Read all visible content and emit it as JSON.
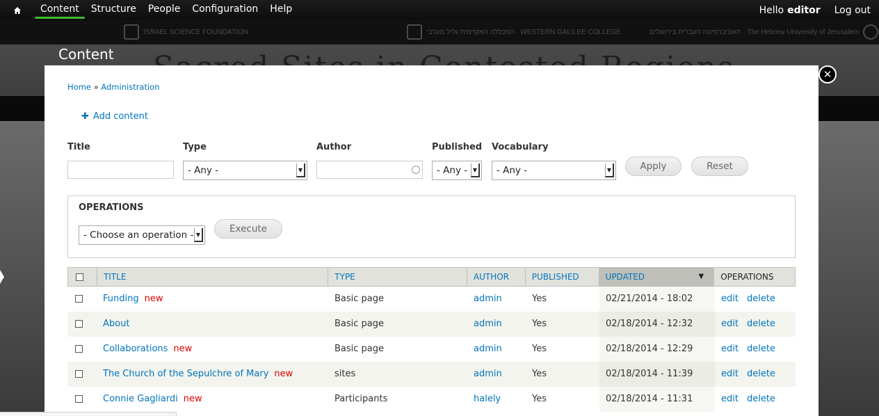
{
  "toolbar": {
    "menu": [
      "Content",
      "Structure",
      "People",
      "Configuration",
      "Help"
    ],
    "hello": "Hello",
    "user": "editor",
    "logout": "Log out"
  },
  "logos": {
    "left": "ISRAEL SCIENCE FOUNDATION",
    "center": "המכללה האקדמית גליל מערבי · WESTERN GALILEE COLLEGE",
    "right": "האוניברסיטה העברית בירושלים · The Hebrew University of Jerusalem"
  },
  "page": {
    "title": "Content",
    "bg_title": "Sacred Sites in Contested Regions"
  },
  "breadcrumb": {
    "home": "Home",
    "sep": "»",
    "admin": "Administration"
  },
  "add_content": "Add content",
  "filters": {
    "title_label": "Title",
    "type_label": "Type",
    "type_value": "- Any -",
    "author_label": "Author",
    "published_label": "Published",
    "published_value": "- Any -",
    "vocabulary_label": "Vocabulary",
    "vocabulary_value": "- Any -",
    "apply": "Apply",
    "reset": "Reset"
  },
  "operations": {
    "legend": "OPERATIONS",
    "select_value": "- Choose an operation -",
    "execute": "Execute"
  },
  "table": {
    "headers": {
      "title": "TITLE",
      "type": "TYPE",
      "author": "AUTHOR",
      "published": "PUBLISHED",
      "updated": "UPDATED",
      "operations": "OPERATIONS"
    },
    "rows": [
      {
        "title": "Funding",
        "new": "new",
        "type": "Basic page",
        "author": "admin",
        "published": "Yes",
        "updated": "02/21/2014 - 18:02",
        "edit": "edit",
        "delete": "delete"
      },
      {
        "title": "About",
        "new": "",
        "type": "Basic page",
        "author": "admin",
        "published": "Yes",
        "updated": "02/18/2014 - 12:32",
        "edit": "edit",
        "delete": "delete"
      },
      {
        "title": "Collaborations",
        "new": "new",
        "type": "Basic page",
        "author": "admin",
        "published": "Yes",
        "updated": "02/18/2014 - 12:29",
        "edit": "edit",
        "delete": "delete"
      },
      {
        "title": "The Church of the Sepulchre of Mary",
        "new": "new",
        "type": "sites",
        "author": "admin",
        "published": "Yes",
        "updated": "02/18/2014 - 11:39",
        "edit": "edit",
        "delete": "delete"
      },
      {
        "title": "Connie Gagliardi",
        "new": "new",
        "type": "Participants",
        "author": "halely",
        "published": "Yes",
        "updated": "02/18/2014 - 11:31",
        "edit": "edit",
        "delete": "delete"
      }
    ]
  }
}
